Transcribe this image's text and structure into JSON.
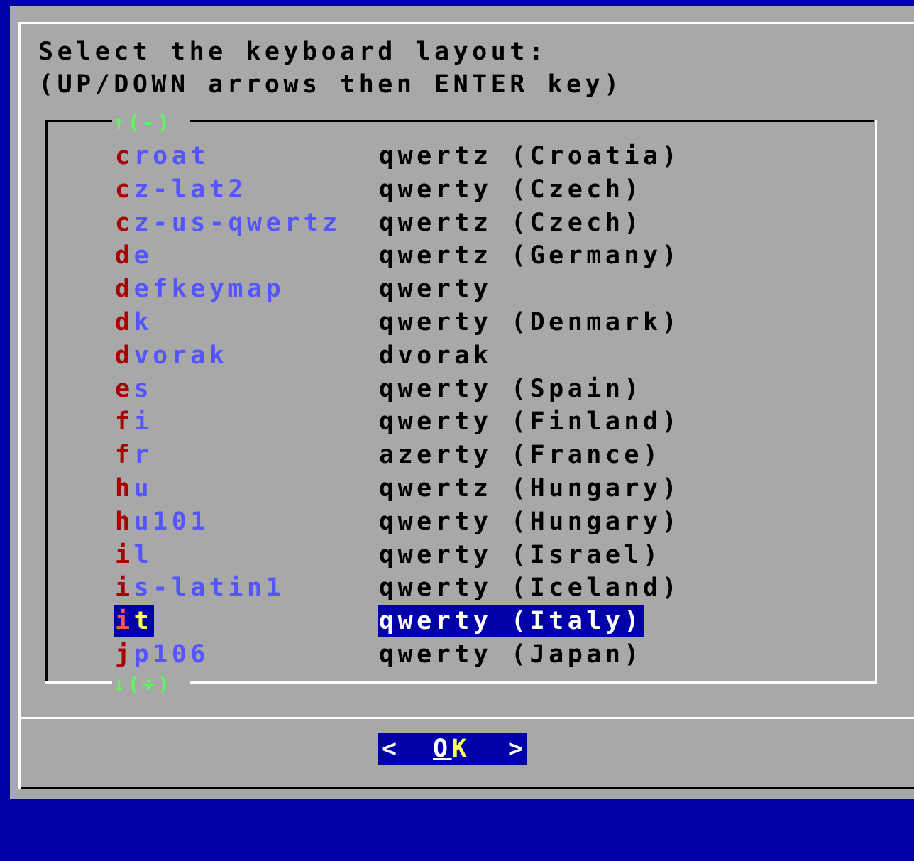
{
  "dialog": {
    "prompt_line1": "Select the keyboard layout:",
    "prompt_line2": "(UP/DOWN arrows then ENTER key)",
    "scroll_up": "↑(-)",
    "scroll_down": "↓(+)",
    "selected_index": 14,
    "items": [
      {
        "hot": "c",
        "rest": "roat",
        "desc": "qwertz (Croatia)"
      },
      {
        "hot": "c",
        "rest": "z-lat2",
        "desc": "qwerty (Czech)"
      },
      {
        "hot": "c",
        "rest": "z-us-qwertz",
        "desc": "qwertz (Czech)"
      },
      {
        "hot": "d",
        "rest": "e",
        "desc": "qwertz (Germany)"
      },
      {
        "hot": "d",
        "rest": "efkeymap",
        "desc": "qwerty"
      },
      {
        "hot": "d",
        "rest": "k",
        "desc": "qwerty (Denmark)"
      },
      {
        "hot": "d",
        "rest": "vorak",
        "desc": "dvorak"
      },
      {
        "hot": "e",
        "rest": "s",
        "desc": "qwerty (Spain)"
      },
      {
        "hot": "f",
        "rest": "i",
        "desc": "qwerty (Finland)"
      },
      {
        "hot": "f",
        "rest": "r",
        "desc": "azerty (France)"
      },
      {
        "hot": "h",
        "rest": "u",
        "desc": "qwertz (Hungary)"
      },
      {
        "hot": "h",
        "rest": "u101",
        "desc": "qwerty (Hungary)"
      },
      {
        "hot": "i",
        "rest": "l",
        "desc": "qwerty (Israel)"
      },
      {
        "hot": "i",
        "rest": "s-latin1",
        "desc": "qwerty (Iceland)"
      },
      {
        "hot": "i",
        "rest": "t",
        "desc": "qwerty (Italy)"
      },
      {
        "hot": "j",
        "rest": "p106",
        "desc": "qwerty (Japan)"
      }
    ],
    "ok_button": {
      "left": "<",
      "hot": "O",
      "rest": "K",
      "right": ">"
    }
  }
}
